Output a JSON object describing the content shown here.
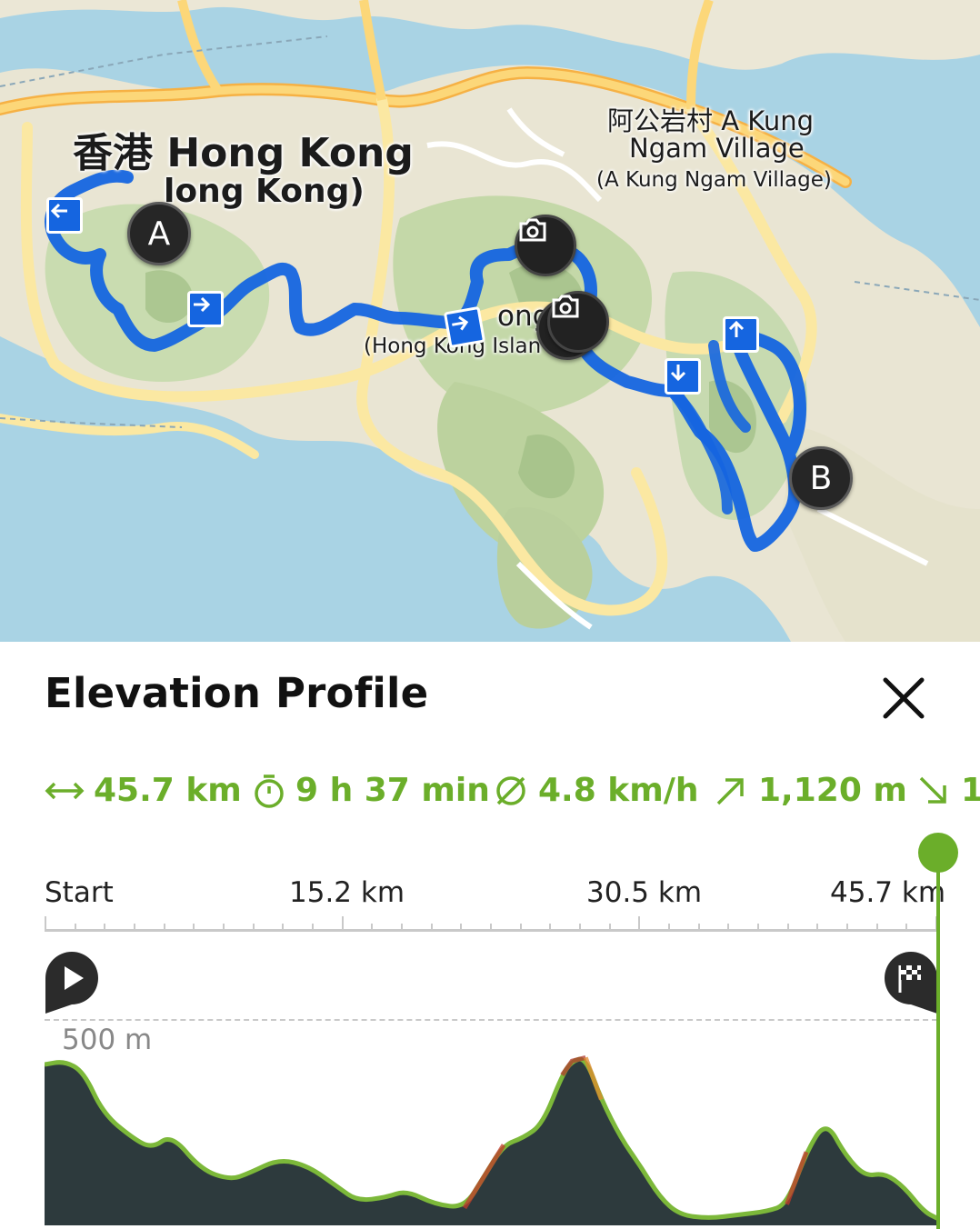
{
  "map": {
    "labels": {
      "hong_kong_main": "香港 Hong Kong",
      "hong_kong_sub": "long Kong)",
      "a_kung_ngam_1": "阿公岩村 A Kung",
      "a_kung_ngam_2": "Ngam Village",
      "a_kung_ngam_3": "(A Kung Ngam Village)",
      "hk_island_1": "ong   nd",
      "hk_island_2": "(Hong Kong Islan"
    },
    "pins": {
      "start": "A",
      "end": "B"
    },
    "route_color": "#1565e0",
    "icons": [
      "camera-icon",
      "direction-arrow-icon"
    ]
  },
  "panel": {
    "title": "Elevation Profile",
    "close_icon": "close-icon",
    "stats": {
      "distance": "45.7 km",
      "duration": "9 h 37 min",
      "avg_speed": "4.8 km/h",
      "ascent": "1,120 m",
      "descent": "1"
    },
    "accent_color": "#6bae2a",
    "axis": {
      "start": "Start",
      "mid1": "15.2 km",
      "mid2": "30.5 km",
      "end": "45.7 km"
    },
    "y_label": "500 m"
  },
  "chart_data": {
    "type": "area",
    "xlabel": "",
    "ylabel": "",
    "x_unit": "km",
    "y_unit": "m",
    "xlim": [
      0,
      45.7
    ],
    "y_reference_label": "500 m",
    "x": [
      0,
      1,
      2,
      3,
      4.5,
      5.5,
      6.5,
      8,
      9.5,
      10.5,
      12,
      13.5,
      15,
      16,
      17.5,
      18.5,
      20,
      21.5,
      22.5,
      23.5,
      24.5,
      25.5,
      26.5,
      27,
      27.7,
      28.5,
      29.5,
      30.5,
      31.5,
      32.5,
      34,
      35.5,
      37,
      38,
      39,
      40,
      41,
      42,
      43,
      44,
      45,
      45.7
    ],
    "y": [
      460,
      470,
      440,
      320,
      250,
      220,
      260,
      160,
      130,
      150,
      190,
      170,
      110,
      70,
      80,
      100,
      60,
      50,
      140,
      230,
      250,
      290,
      430,
      470,
      480,
      360,
      250,
      170,
      80,
      30,
      20,
      30,
      40,
      60,
      210,
      300,
      200,
      140,
      150,
      110,
      40,
      20
    ],
    "series_color": "#7cb83a",
    "fill_color": "#2d3a3d"
  }
}
